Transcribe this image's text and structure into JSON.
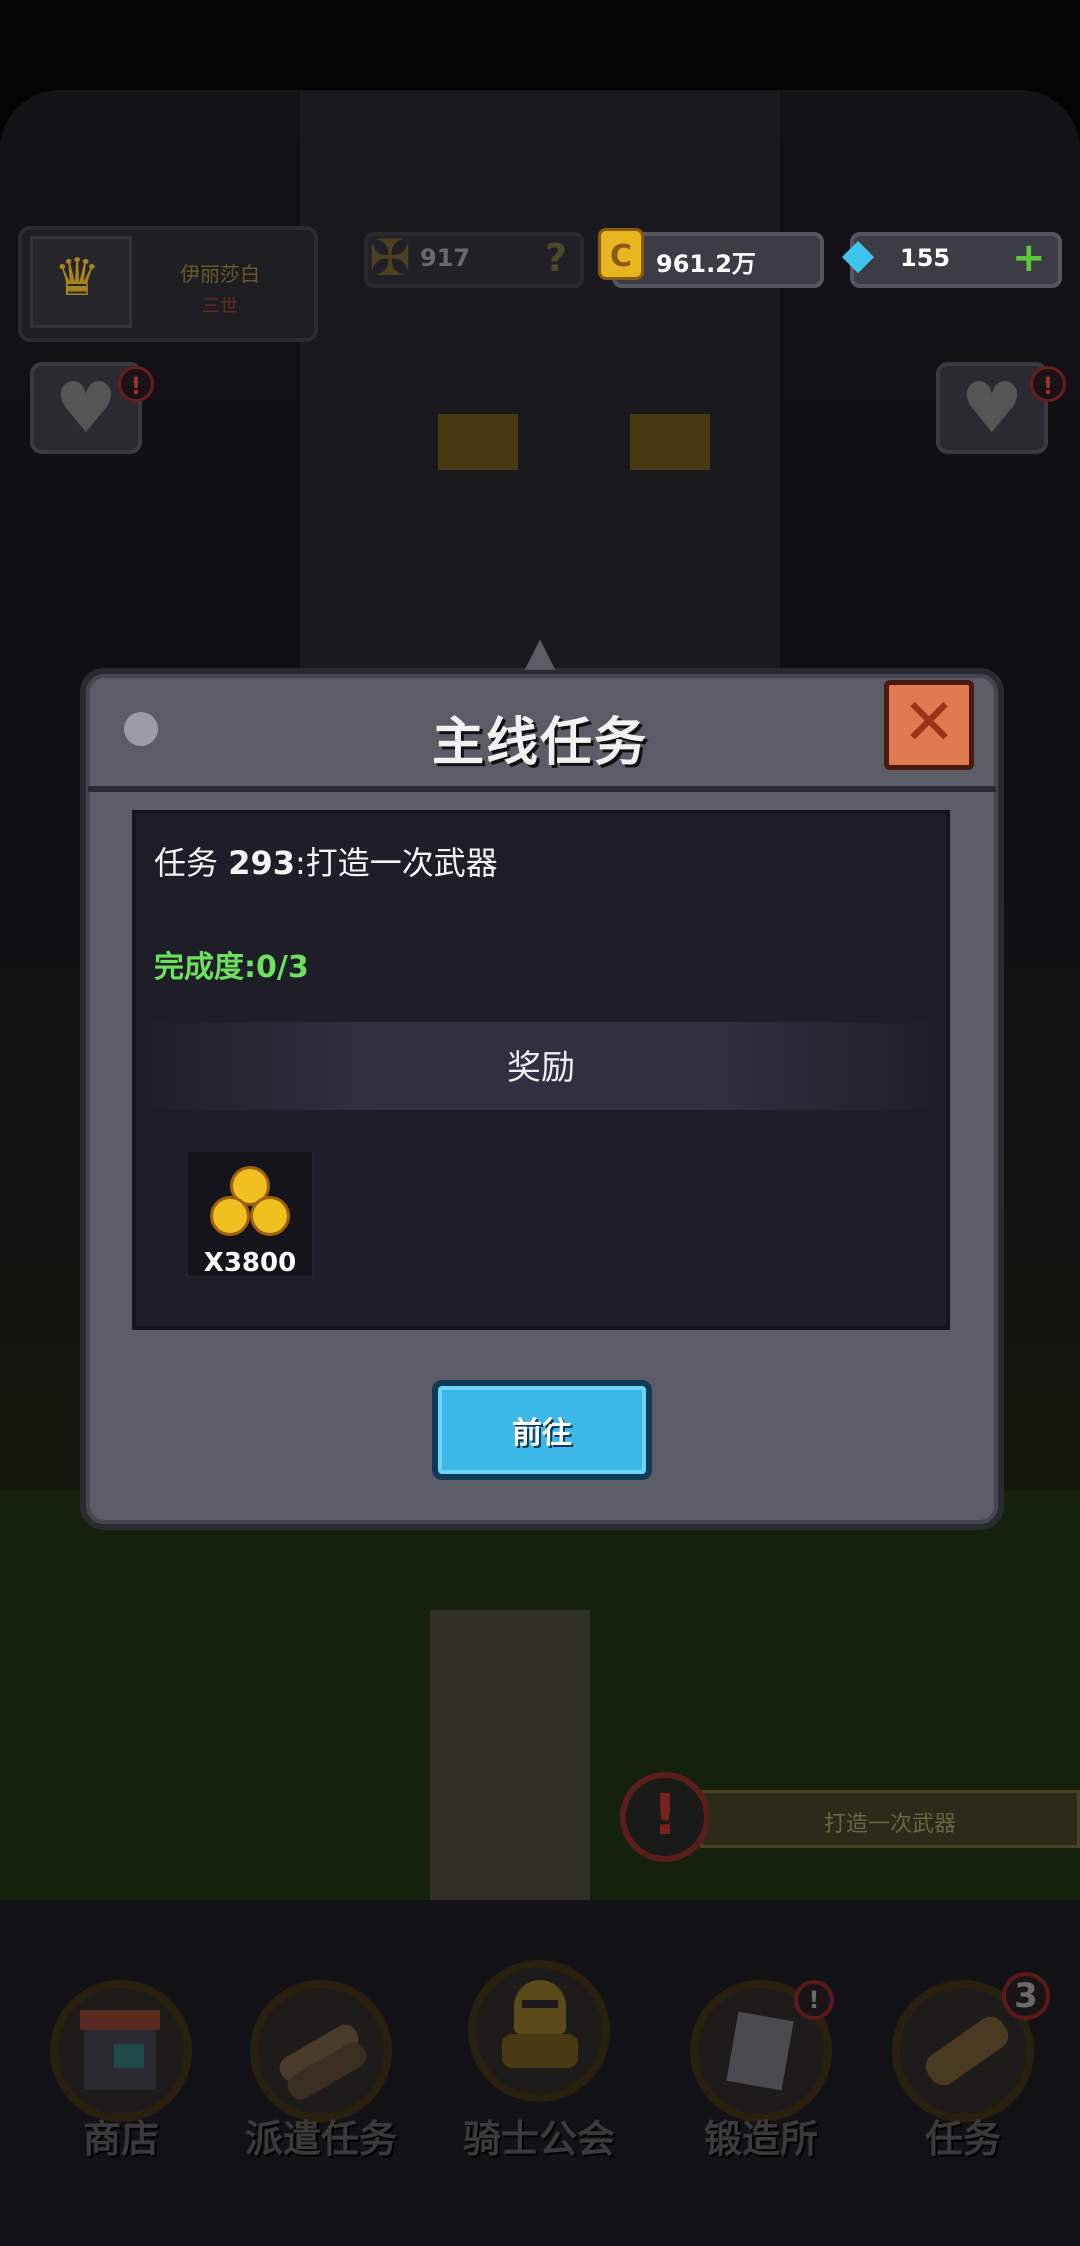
{
  "hud": {
    "player_name": "伊丽莎白",
    "player_rank": "三世",
    "power_value": "917",
    "power_help": "?",
    "gold_value": "961.2万",
    "gem_value": "155",
    "gem_add": "+"
  },
  "modal": {
    "title": "主线任务",
    "quest_prefix": "任务 ",
    "quest_number": "293",
    "quest_desc": ":打造一次武器",
    "progress": "完成度:0/3",
    "reward_label": "奖励",
    "reward_qty": "X3800",
    "go_button": "前往"
  },
  "quest_hint": {
    "icon": "!",
    "text": "打造一次武器"
  },
  "nav": {
    "items": [
      {
        "label": "商店",
        "icon": "shop-icon"
      },
      {
        "label": "派遣任务",
        "icon": "logs-icon"
      },
      {
        "label": "骑士公会",
        "icon": "knight-icon"
      },
      {
        "label": "锻造所",
        "icon": "anvil-icon",
        "alert": "!"
      },
      {
        "label": "任务",
        "icon": "scroll-icon",
        "badge": "3"
      }
    ]
  },
  "colors": {
    "accent_blue": "#3cb8e8",
    "close_orange": "#e07a50",
    "progress_green": "#6ee060",
    "gold": "#f0c020"
  }
}
